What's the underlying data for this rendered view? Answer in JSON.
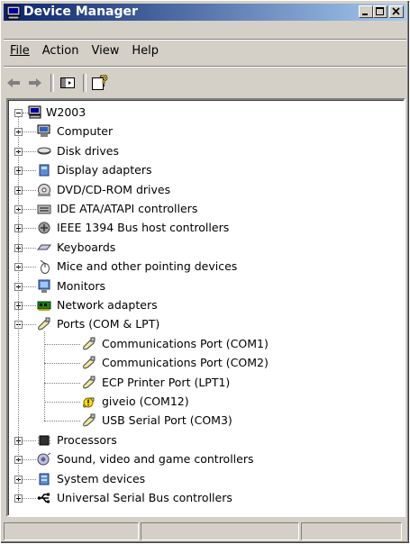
{
  "window": {
    "title": "Device Manager"
  },
  "menu": [
    {
      "label": "File"
    },
    {
      "label": "Action"
    },
    {
      "label": "View"
    },
    {
      "label": "Help"
    }
  ],
  "tree": {
    "root": "W2003",
    "items": [
      {
        "label": "Computer",
        "icon": "computer-icon"
      },
      {
        "label": "Disk drives",
        "icon": "disk-drive-icon"
      },
      {
        "label": "Display adapters",
        "icon": "display-adapter-icon"
      },
      {
        "label": "DVD/CD-ROM drives",
        "icon": "dvd-drive-icon"
      },
      {
        "label": "IDE ATA/ATAPI controllers",
        "icon": "ide-controller-icon"
      },
      {
        "label": "IEEE 1394 Bus host controllers",
        "icon": "ieee1394-icon"
      },
      {
        "label": "Keyboards",
        "icon": "keyboard-icon"
      },
      {
        "label": "Mice and other pointing devices",
        "icon": "mouse-icon"
      },
      {
        "label": "Monitors",
        "icon": "monitor-icon"
      },
      {
        "label": "Network adapters",
        "icon": "network-adapter-icon"
      },
      {
        "label": "Ports (COM & LPT)",
        "icon": "port-icon",
        "expanded": true,
        "children": [
          {
            "label": "Communications Port (COM1)",
            "icon": "port-icon"
          },
          {
            "label": "Communications Port (COM2)",
            "icon": "port-icon"
          },
          {
            "label": "ECP Printer Port (LPT1)",
            "icon": "port-icon"
          },
          {
            "label": "giveio (COM12)",
            "icon": "warning-icon"
          },
          {
            "label": "USB Serial Port (COM3)",
            "icon": "port-icon"
          }
        ]
      },
      {
        "label": "Processors",
        "icon": "processor-icon"
      },
      {
        "label": "Sound, video and game controllers",
        "icon": "sound-icon"
      },
      {
        "label": "System devices",
        "icon": "system-device-icon"
      },
      {
        "label": "Universal Serial Bus controllers",
        "icon": "usb-icon"
      }
    ]
  },
  "colors": {
    "titlebar_start": "#0a246a",
    "titlebar_end": "#a6caf0",
    "face": "#d4d0c8"
  }
}
